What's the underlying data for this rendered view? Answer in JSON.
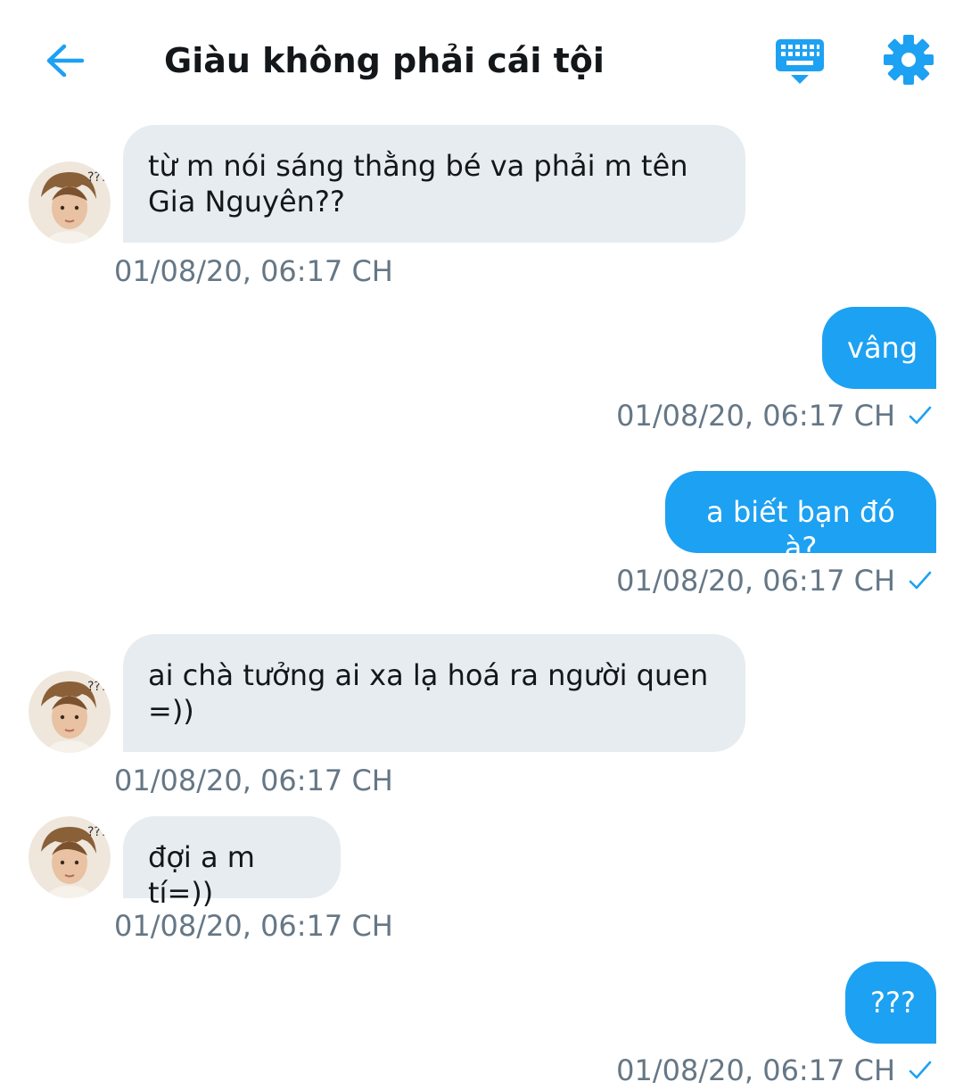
{
  "header": {
    "title": "Giàu không phải cái tội",
    "back_icon": "arrow-left-icon",
    "keyboard_icon": "keyboard-icon",
    "settings_icon": "gear-icon"
  },
  "colors": {
    "accent": "#1da1f2",
    "incoming_bubble": "#e6ecf0",
    "timestamp": "#657786"
  },
  "messages": [
    {
      "direction": "in",
      "text_lines": [
        "từ m nói sáng thằng bé va phải m tên",
        "Gia Nguyên??"
      ],
      "time": "01/08/20, 06:17 CH"
    },
    {
      "direction": "out",
      "text": "vâng",
      "time": "01/08/20, 06:17 CH",
      "read": true
    },
    {
      "direction": "out",
      "text": "a biết bạn đó à?",
      "time": "01/08/20, 06:17 CH",
      "read": true
    },
    {
      "direction": "in",
      "text_lines": [
        "ai chà tưởng ai xa lạ hoá ra người quen",
        "=))"
      ],
      "time": "01/08/20, 06:17 CH"
    },
    {
      "direction": "in",
      "text_lines": [
        "đợi a m tí=))"
      ],
      "time": "01/08/20, 06:17 CH"
    },
    {
      "direction": "out",
      "text": "???",
      "time": "01/08/20, 06:17 CH",
      "read": true
    }
  ]
}
